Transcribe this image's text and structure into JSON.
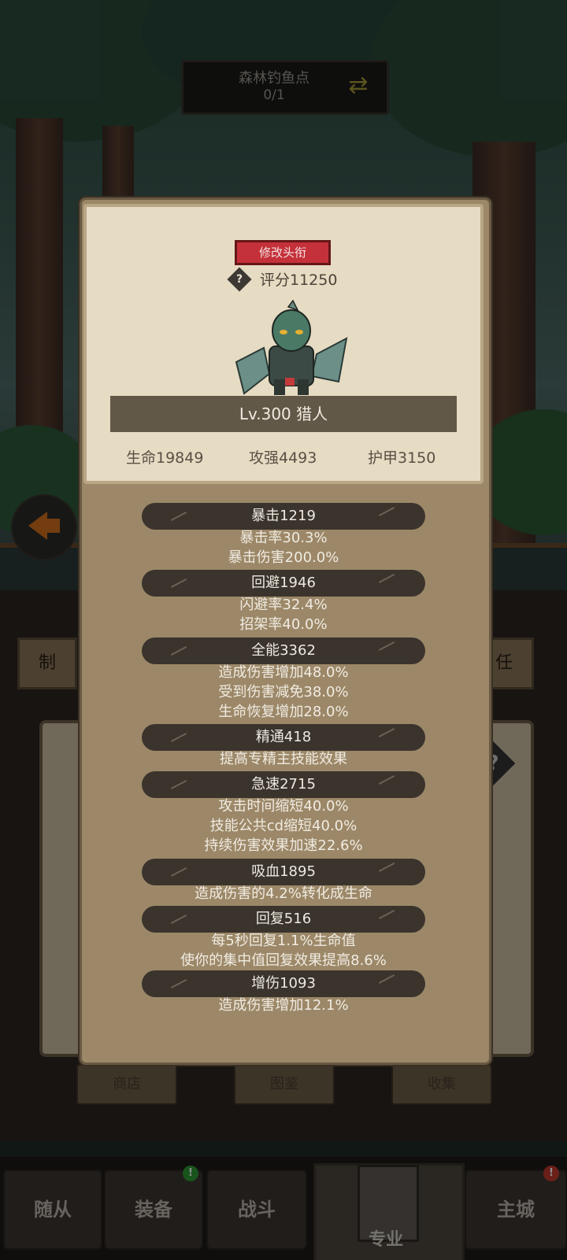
{
  "location": {
    "name": "森林钓鱼点",
    "progress": "0/1"
  },
  "profile": {
    "title_button": "修改头衔",
    "score": "评分11250",
    "level_class": "Lv.300 猎人",
    "stats": {
      "hp": "生命19849",
      "attack": "攻强4493",
      "armor": "护甲3150"
    }
  },
  "attributes": [
    {
      "header": "暴击1219",
      "details": [
        "暴击率30.3%",
        "暴击伤害200.0%"
      ]
    },
    {
      "header": "回避1946",
      "details": [
        "闪避率32.4%",
        "招架率40.0%"
      ]
    },
    {
      "header": "全能3362",
      "details": [
        "造成伤害增加48.0%",
        "受到伤害减免38.0%",
        "生命恢复增加28.0%"
      ]
    },
    {
      "header": "精通418",
      "details": [
        "提高专精主技能效果"
      ]
    },
    {
      "header": "急速2715",
      "details": [
        "攻击时间缩短40.0%",
        "技能公共cd缩短40.0%",
        "持续伤害效果加速22.6%"
      ]
    },
    {
      "header": "吸血1895",
      "details": [
        "造成伤害的4.2%转化成生命"
      ]
    },
    {
      "header": "回复516",
      "details": [
        "每5秒回复1.1%生命值",
        "使你的集中值回复效果提高8.6%"
      ]
    },
    {
      "header": "增伤1093",
      "details": [
        "造成伤害增加12.1%"
      ]
    }
  ],
  "background": {
    "tab_left": "制",
    "tab_right": "任",
    "buttons": [
      "商店",
      "图鉴",
      "收集"
    ]
  },
  "bottom_nav": {
    "items": [
      "随从",
      "装备",
      "战斗",
      "专业",
      "主城"
    ],
    "active": "专业",
    "badge_equipment": "!",
    "badge_city": "!"
  },
  "colors": {
    "badge_green": "#2e9a36",
    "badge_red": "#c23a2c",
    "title_red": "#c5313a"
  }
}
